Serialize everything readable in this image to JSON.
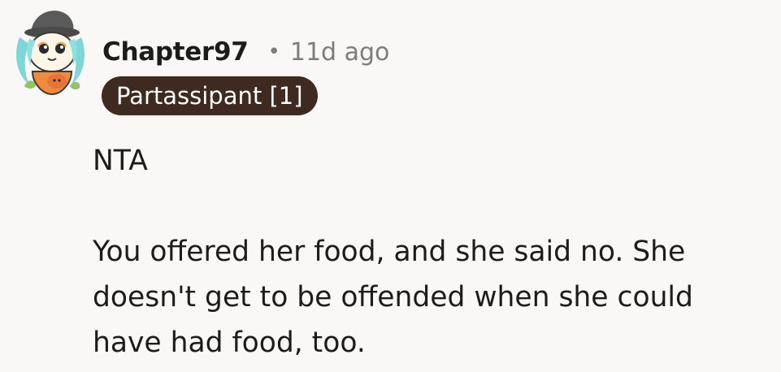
{
  "comment": {
    "author": "Chapter97",
    "separator": "•",
    "timestamp": "11d ago",
    "flair": "Partassipant [1]",
    "paragraphs": [
      "NTA",
      "You offered her food, and she said no. She doesn't get to be offended when she could have had food, too."
    ]
  },
  "colors": {
    "background": "#f9f8f7",
    "flair_background": "#3f2a20",
    "flair_text": "#ffffff",
    "meta_text": "#7c7c7c",
    "body_text": "#1c1c1c"
  },
  "icons": {
    "avatar": "snoo-avatar-icon"
  }
}
